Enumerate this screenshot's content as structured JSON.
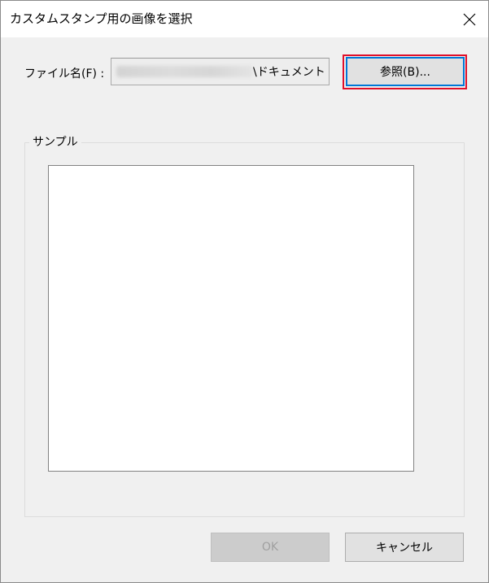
{
  "window": {
    "title": "カスタムスタンプ用の画像を選択",
    "close_icon": "close-icon"
  },
  "file": {
    "label": "ファイル名(F) :",
    "value": "\\ドキュメント"
  },
  "buttons": {
    "browse_label": "参照(B)...",
    "ok_label": "OK",
    "cancel_label": "キャンセル"
  },
  "sample": {
    "label": "サンプル"
  },
  "colors": {
    "highlight": "#e0102a",
    "focus_border": "#0078d7"
  }
}
